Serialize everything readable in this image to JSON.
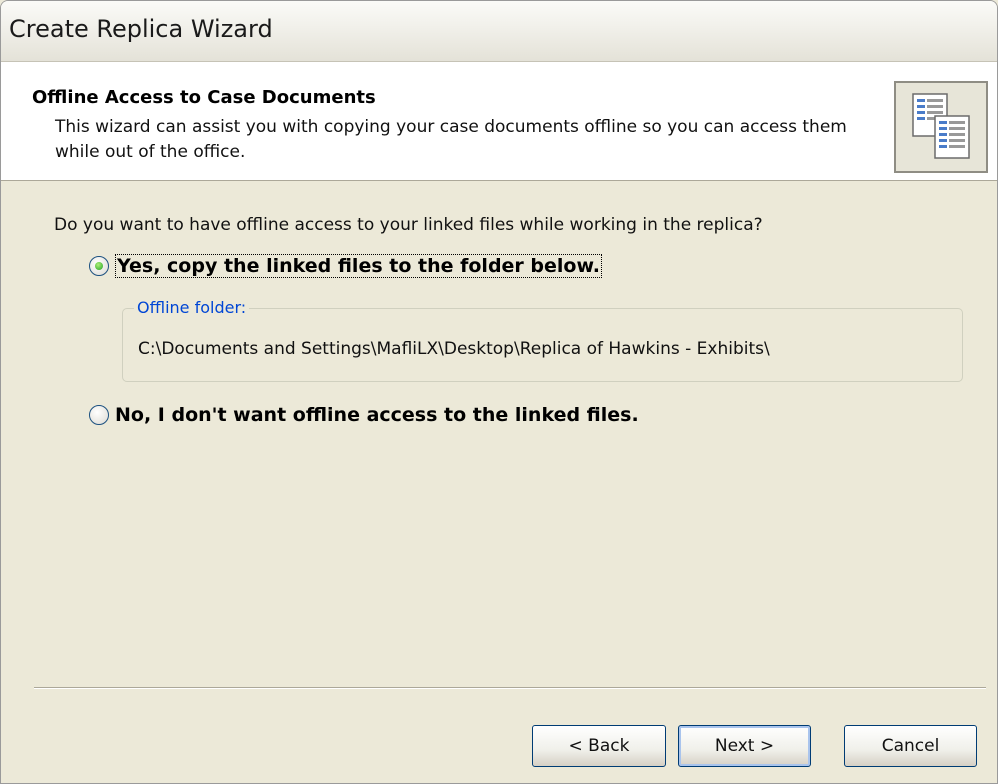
{
  "window": {
    "title": "Create Replica Wizard"
  },
  "header": {
    "title": "Offline Access to Case Documents",
    "description": "This wizard can assist you with copying your case documents offline so you can access them while out of the office.",
    "icon": "documents-copy-icon"
  },
  "body": {
    "question": "Do you want to have offline access to your linked files while working in the replica?",
    "options": [
      {
        "label": "Yes, copy the linked files to the folder below.",
        "selected": true
      },
      {
        "label": "No, I don't want offline access to the linked files.",
        "selected": false
      }
    ],
    "offline_folder": {
      "legend": "Offline folder:",
      "path": "C:\\Documents and Settings\\MafliLX\\Desktop\\Replica of Hawkins - Exhibits\\"
    }
  },
  "buttons": {
    "back": "< Back",
    "next": "Next >",
    "cancel": "Cancel"
  },
  "colors": {
    "face": "#ece9d8",
    "accent_blue": "#0046d5",
    "radio_green": "#21a121",
    "button_border": "#003c74"
  }
}
